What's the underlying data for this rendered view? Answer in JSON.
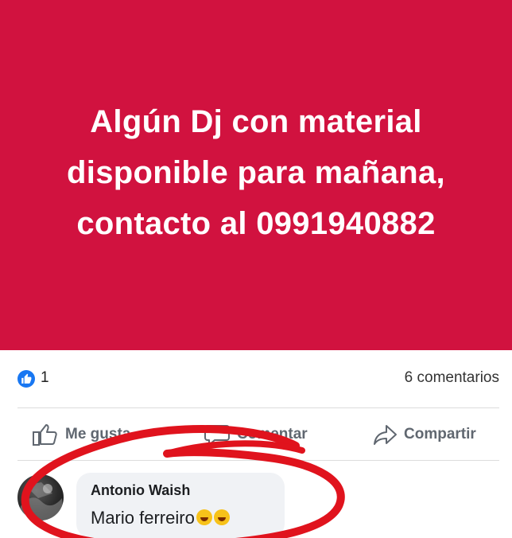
{
  "post": {
    "text": "Algún Dj con material disponible para mañana, contacto al 0991940882",
    "background_color": "#d1123f"
  },
  "stats": {
    "like_count": "1",
    "comments": "6 comentarios",
    "reaction_icon": "thumbs-up-icon"
  },
  "actions": {
    "like_label": "Me gusta",
    "comment_label": "Comentar",
    "share_label": "Compartir"
  },
  "comment": {
    "author": "Antonio Waish",
    "text": "Mario ferreiro",
    "emojis": [
      "rolling-on-floor-laughing-emoji",
      "rolling-on-floor-laughing-emoji"
    ]
  },
  "annotation": {
    "color": "#e0131d",
    "shape": "hand-drawn-circle"
  }
}
